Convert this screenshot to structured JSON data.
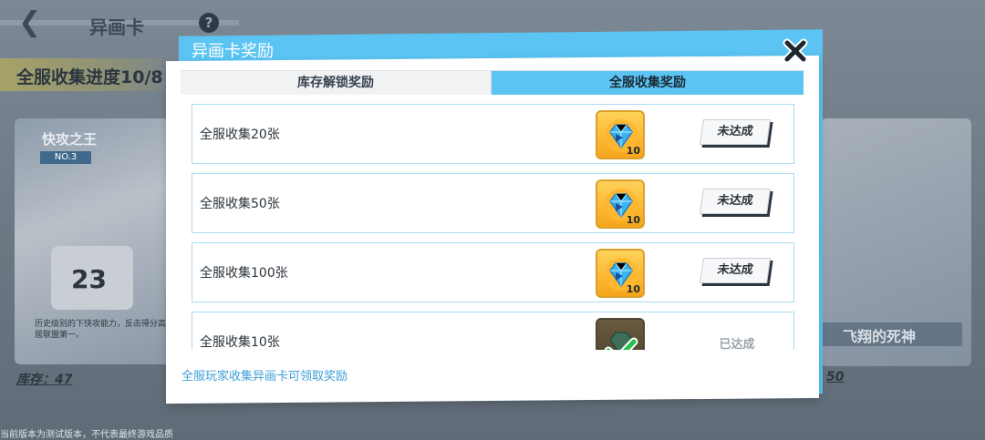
{
  "background": {
    "back_label": "❮",
    "title": "异画卡",
    "help_label": "?",
    "progress": "全服收集进度10/8",
    "left_card": {
      "name": "快攻之王",
      "no": "NO.3",
      "jersey_number": "23",
      "desc": "历史级别的下快攻能力，反击得分高居联盟第一。",
      "stock": "库存：47"
    },
    "right_card": {
      "name": "飞翔的死神",
      "stock": "50"
    },
    "footer": "当前版本为测试版本，不代表最终游戏品质"
  },
  "modal": {
    "title": "异画卡奖励",
    "tabs": [
      {
        "label": "库存解锁奖励",
        "active": false
      },
      {
        "label": "全服收集奖励",
        "active": true
      }
    ],
    "rows": [
      {
        "label": "全服收集20张",
        "reward_count": "10",
        "status": "未达成",
        "claimed": false
      },
      {
        "label": "全服收集50张",
        "reward_count": "10",
        "status": "未达成",
        "claimed": false
      },
      {
        "label": "全服收集100张",
        "reward_count": "10",
        "status": "未达成",
        "claimed": false
      },
      {
        "label": "全服收集10张",
        "reward_count": "",
        "status": "已达成",
        "claimed": true
      }
    ],
    "footer_note": "全服玩家收集异画卡可领取奖励"
  },
  "colors": {
    "accent": "#5bc4f2",
    "row_border": "#a8dcf5",
    "footer_text": "#3d9fd6",
    "reward_gold": "#f6a51b"
  }
}
